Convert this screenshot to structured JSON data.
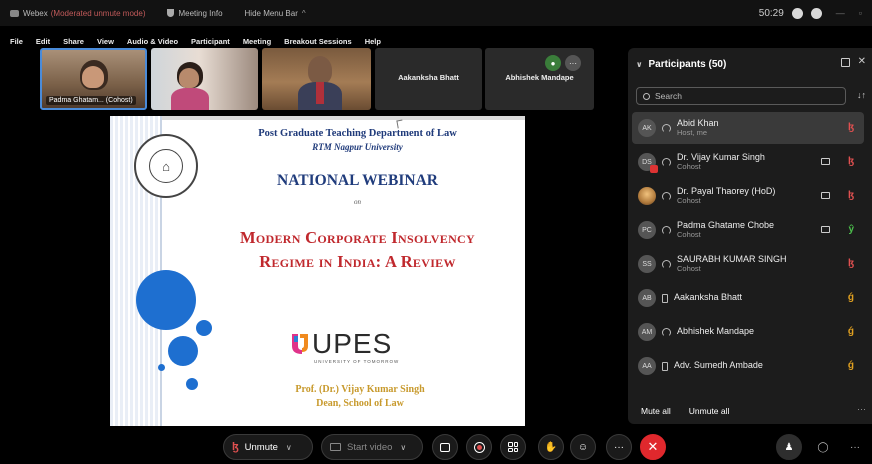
{
  "titlebar": {
    "app_name": "Webex",
    "mode": "(Moderated unmute mode)",
    "meeting_info": "Meeting Info",
    "hide_menu": "Hide Menu Bar",
    "time": "50:29"
  },
  "menu": [
    "File",
    "Edit",
    "Share",
    "View",
    "Audio & Video",
    "Participant",
    "Meeting",
    "Breakout Sessions",
    "Help"
  ],
  "video_strip": {
    "tile1_name": "Padma Ghatam... (Cohost)",
    "tile4_name": "Aakanksha Bhatt",
    "tile5_name": "Abhishek Mandape"
  },
  "slide": {
    "department": "Post Graduate Teaching Department of Law",
    "university": "RTM Nagpur University",
    "event": "NATIONAL WEBINAR",
    "on": "on",
    "topic_line1": "Modern Corporate Insolvency",
    "topic_line2": "Regime in India: A Review",
    "sponsor_logo": "UPES",
    "sponsor_tagline": "UNIVERSITY OF TOMORROW",
    "speaker": "Prof. (Dr.) Vijay Kumar Singh",
    "speaker_title": "Dean, School of Law"
  },
  "participants": {
    "title": "Participants (50)",
    "search_placeholder": "Search",
    "list": [
      {
        "initials": "AK",
        "name": "Abid Khan",
        "role": "Host, me",
        "audio": "muted",
        "active": true
      },
      {
        "initials": "DS",
        "name": "Dr. Vijay Kumar Singh",
        "role": "Cohost",
        "video": true,
        "audio": "muted"
      },
      {
        "initials": "",
        "name": "Dr. Payal Thaorey (HoD)",
        "role": "Cohost",
        "video": true,
        "audio": "muted"
      },
      {
        "initials": "PC",
        "name": "Padma Ghatame Chobe",
        "role": "Cohost",
        "video": true,
        "audio": "unmuted"
      },
      {
        "initials": "SS",
        "name": "SAURABH KUMAR SINGH",
        "role": "Cohost",
        "audio": "muted"
      },
      {
        "initials": "AB",
        "name": "Aakanksha Bhatt",
        "role": "",
        "audio": "request"
      },
      {
        "initials": "AM",
        "name": "Abhishek Mandape",
        "role": "",
        "audio": "request"
      },
      {
        "initials": "AA",
        "name": "Adv. Sumedh Ambade",
        "role": "",
        "audio": "request"
      }
    ],
    "mute_all": "Mute all",
    "unmute_all": "Unmute all"
  },
  "toolbar": {
    "unmute_label": "Unmute",
    "start_video_label": "Start video",
    "end_icon": "✕",
    "chat_icon": "◯",
    "more_icon": "···"
  },
  "colors": {
    "accent_blue": "#1e6fd0",
    "end_red": "#e0282d",
    "mute_red": "#e05050",
    "slide_title_blue": "#1f3a7a",
    "topic_red": "#c0282d",
    "speaker_gold": "#c89a2d"
  }
}
